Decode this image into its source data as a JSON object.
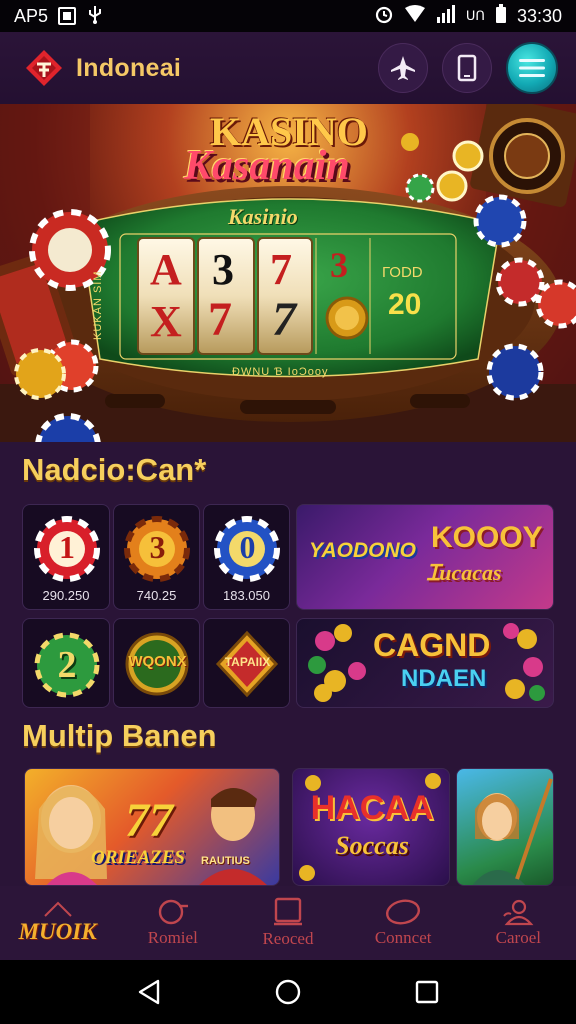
{
  "status_bar": {
    "carrier": "AP5",
    "network": "ᑌᑎ",
    "time": "33:30"
  },
  "header": {
    "title": "Indoneai"
  },
  "hero": {
    "title_top": "KASINO",
    "title_main": "Kasanain",
    "table_label": "Kasinio",
    "reels": [
      "A",
      "3",
      "7",
      "3",
      "X",
      "7",
      "7"
    ],
    "payout_label": "ГОDD",
    "payout_value": "20",
    "side_text": "KUKAN SIM",
    "felt_text": "ÐWNU Ɓ IoƆooy"
  },
  "section1": {
    "title": "Nadcio:Can*",
    "tiles": [
      {
        "chip": "1",
        "label": "290.250",
        "color": "#d81f2a"
      },
      {
        "chip": "3",
        "label": "740.25",
        "color": "#e3801b"
      },
      {
        "chip": "0",
        "label": "183.050",
        "color": "#2352c4"
      },
      {
        "chip": "2",
        "label": "",
        "color": "#2d9a3e"
      },
      {
        "chip": "WQONX",
        "label": "",
        "color": "#d8a323"
      },
      {
        "chip": "TAPAIIX",
        "label": "",
        "color": "#e6a324"
      }
    ],
    "banner1": {
      "left": "YAODONO",
      "right_top": "KOOOY",
      "right_bottom": "Ɪucacas"
    },
    "banner2": {
      "top": "CAGND",
      "bottom": "NDAEN"
    }
  },
  "section2": {
    "title": "Multip Banen",
    "banner_a": {
      "number": "77",
      "text": "ORIEAZES",
      "tag": "RAUTIUS"
    },
    "banner_b": {
      "top": "HACAA",
      "bottom": "Soccas"
    }
  },
  "bottom_nav": [
    {
      "label": "MUOIK",
      "icon": "home-icon",
      "active": true
    },
    {
      "label": "Romiel",
      "icon": "search-icon",
      "active": false
    },
    {
      "label": "Reoced",
      "icon": "tablet-icon",
      "active": false
    },
    {
      "label": "Conncet",
      "icon": "chat-icon",
      "active": false
    },
    {
      "label": "Caroel",
      "icon": "user-icon",
      "active": false
    }
  ],
  "colors": {
    "accent": "#f6cf5d",
    "bg": "#2a1437",
    "nav_inactive": "#c0464e"
  }
}
